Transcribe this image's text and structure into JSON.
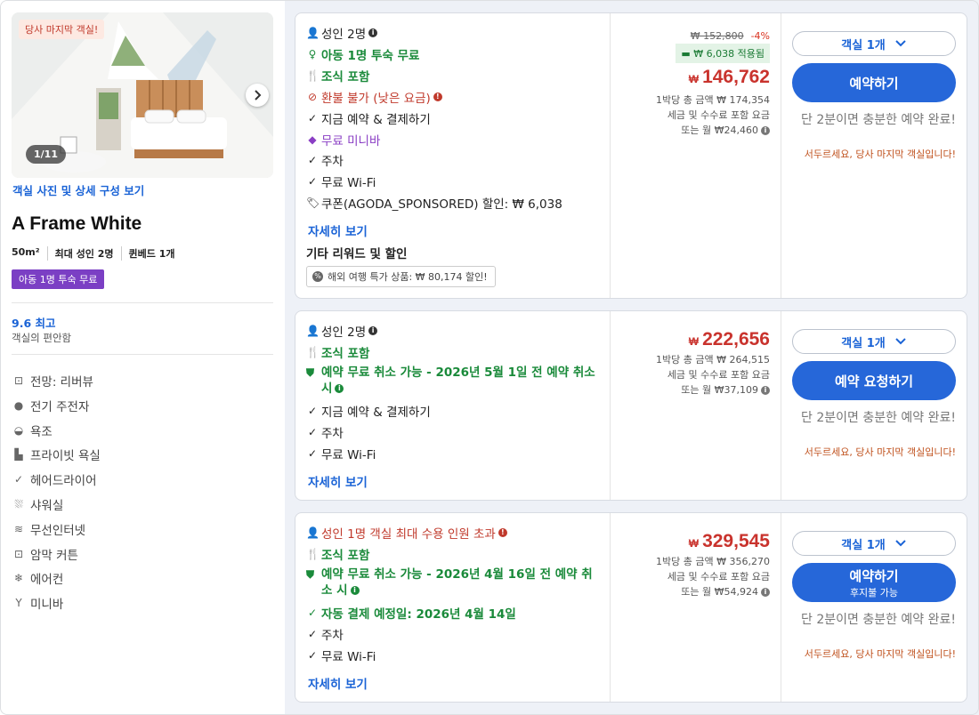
{
  "left": {
    "badge": "당사 마지막 객실!",
    "photo_counter": "1/11",
    "photo_link": "객실 사진 및 상세 구성 보기",
    "title": "A Frame White",
    "specs": [
      "50m²",
      "최대 성인 2명",
      "퀸베드 1개"
    ],
    "kid_badge": "아동 1명 투숙 무료",
    "rating": "9.6 최고",
    "rating_sub": "객실의 편안함",
    "amenities": [
      {
        "icon": "view-icon",
        "label": "전망: 리버뷰"
      },
      {
        "icon": "ev-charger-icon",
        "label": "전기 주전자"
      },
      {
        "icon": "bathtub-icon",
        "label": "욕조"
      },
      {
        "icon": "private-bath-icon",
        "label": "프라이빗 욕실"
      },
      {
        "icon": "check-icon",
        "label": "헤어드라이어"
      },
      {
        "icon": "shower-icon",
        "label": "샤워실"
      },
      {
        "icon": "wifi-icon",
        "label": "무선인터넷"
      },
      {
        "icon": "blackout-icon",
        "label": "암막 커튼"
      },
      {
        "icon": "snowflake-icon",
        "label": "에어컨"
      },
      {
        "icon": "cocktail-icon",
        "label": "미니바"
      }
    ]
  },
  "cards": [
    {
      "features": [
        "성인 2명",
        "아동 1명 투숙 무료",
        "조식 포함",
        "환불 불가 (낮은 요금)",
        "지금 예약 & 결제하기",
        "무료 미니바",
        "주차",
        "무료 Wi-Fi",
        "쿠폰(AGODA_SPONSORED) 할인: ₩ 6,038"
      ],
      "more": "자세히 보기",
      "other_title": "기타 리워드 및 할인",
      "promo": "해외 여행 특가 상품: ₩ 80,174 할인!",
      "original_price": "₩ 152,800",
      "discount": "-4%",
      "applied": "₩ 6,038 적용됨",
      "currency": "₩",
      "price": "146,762",
      "total": "1박당 총 금액 ₩ 174,354",
      "tax": "세금 및 수수료 포함 요금",
      "monthly": "또는 월 ₩24,460",
      "select": "객실 1개",
      "book": "예약하기",
      "book_sub": "",
      "easy": "단 2분이면 충분한 예약 완료!",
      "hurry": "서두르세요, 당사 마지막 객실입니다!"
    },
    {
      "features": [
        "성인 2명",
        "조식 포함",
        "예약 무료 취소 가능 - 2026년 5월 1일 전 예약 취소 시",
        "지금 예약 & 결제하기",
        "주차",
        "무료 Wi-Fi"
      ],
      "more": "자세히 보기",
      "currency": "₩",
      "price": "222,656",
      "total": "1박당 총 금액 ₩ 264,515",
      "tax": "세금 및 수수료 포함 요금",
      "monthly": "또는 월 ₩37,109",
      "select": "객실 1개",
      "book": "예약 요청하기",
      "book_sub": "",
      "easy": "단 2분이면 충분한 예약 완료!",
      "hurry": "서두르세요, 당사 마지막 객실입니다!"
    },
    {
      "features": [
        "성인 1명 객실 최대 수용 인원 초과",
        "조식 포함",
        "예약 무료 취소 가능 - 2026년 4월 16일 전 예약 취소 시",
        "자동 결제 예정일: 2026년 4월 14일",
        "주차",
        "무료 Wi-Fi"
      ],
      "more": "자세히 보기",
      "currency": "₩",
      "price": "329,545",
      "total": "1박당 총 금액 ₩ 356,270",
      "tax": "세금 및 수수료 포함 요금",
      "monthly": "또는 월 ₩54,924",
      "select": "객실 1개",
      "book": "예약하기",
      "book_sub": "후지불 가능",
      "easy": "단 2분이면 충분한 예약 완료!",
      "hurry": "서두르세요, 당사 마지막 객실입니다!"
    }
  ]
}
